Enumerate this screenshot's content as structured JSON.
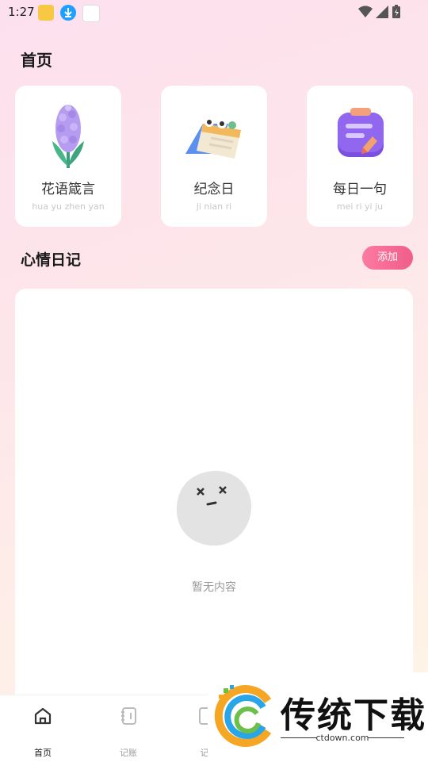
{
  "status_bar": {
    "time": "1:27"
  },
  "header": {
    "title": "首页"
  },
  "cards": [
    {
      "title": "花语箴言",
      "subtitle": "hua yu zhen yan",
      "icon": "hyacinth-flower-icon"
    },
    {
      "title": "纪念日",
      "subtitle": "ji nian ri",
      "icon": "calendar-icon"
    },
    {
      "title": "每日一句",
      "subtitle": "mei ri yi ju",
      "icon": "notepad-pen-icon"
    }
  ],
  "mood_diary": {
    "title": "心情日记",
    "add_label": "添加",
    "empty_text": "暂无内容"
  },
  "tabbar": {
    "items": [
      {
        "label": "首页",
        "icon": "home-icon",
        "active": true
      },
      {
        "label": "记账",
        "icon": "notebook-icon",
        "active": false
      },
      {
        "label": "记",
        "icon": "edit-icon",
        "active": false
      }
    ]
  },
  "watermark": {
    "brand": "传统下载",
    "url": "ctdown.com"
  },
  "colors": {
    "accent": "#f15d8a",
    "text_primary": "#1a1a1a",
    "text_muted": "#999999"
  }
}
